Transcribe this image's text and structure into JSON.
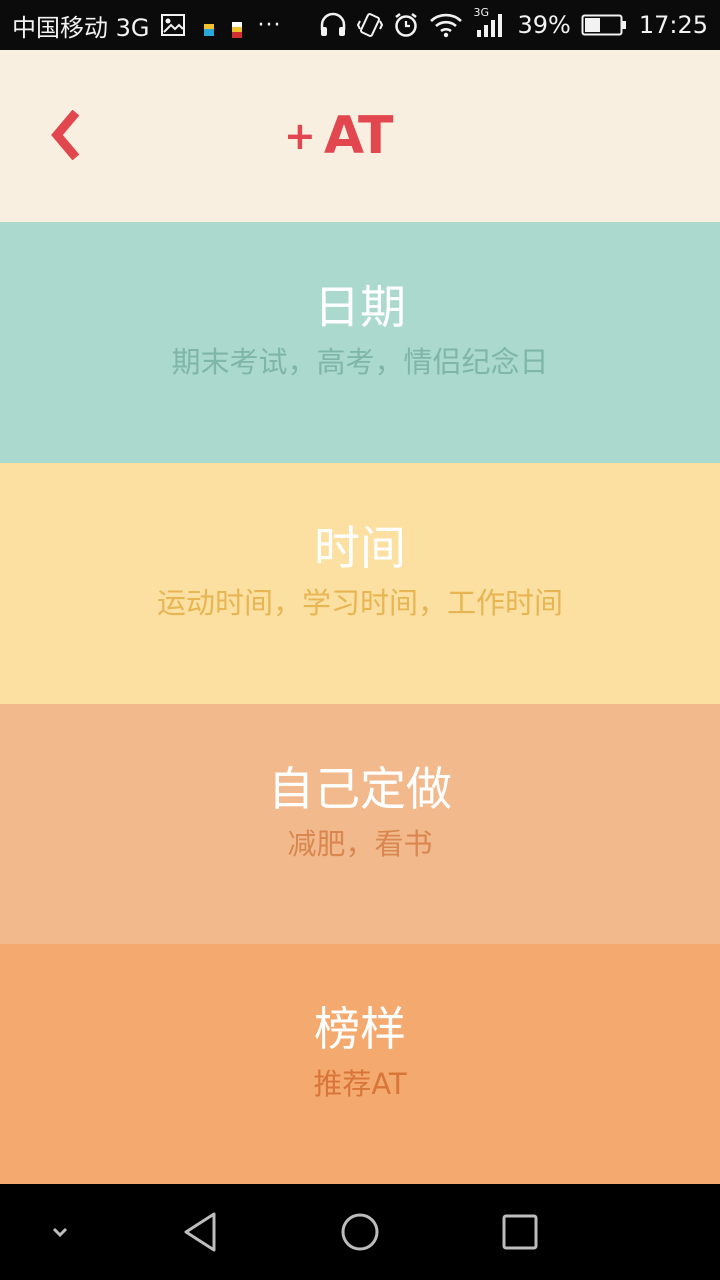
{
  "status_bar": {
    "carrier": "中国移动 3G",
    "network_type": "3G",
    "battery_percent": "39%",
    "time": "17:25",
    "overflow": "···",
    "icons": [
      "image-icon",
      "app-notification-icon",
      "app-notification-icon",
      "headphones-icon",
      "vibrate-icon",
      "alarm-icon",
      "wifi-icon",
      "signal-icon",
      "battery-icon"
    ]
  },
  "header": {
    "back_icon": "chevron-left-icon",
    "logo_plus": "+",
    "logo_text": "AT",
    "accent_color": "#e2474f"
  },
  "categories": [
    {
      "title": "日期",
      "subtitle": "期末考试，高考，情侣纪念日",
      "bg": "#abd9cd"
    },
    {
      "title": "时间",
      "subtitle": "运动时间，学习时间，工作时间",
      "bg": "#fbe0a1"
    },
    {
      "title": "自己定做",
      "subtitle": "减肥，看书",
      "bg": "#f2b98d"
    },
    {
      "title": "榜样",
      "subtitle": "推荐AT",
      "bg": "#f4aa6f"
    }
  ],
  "nav_bar": {
    "icons": [
      "chevron-down-icon",
      "back-triangle-icon",
      "home-circle-icon",
      "recents-square-icon"
    ]
  }
}
